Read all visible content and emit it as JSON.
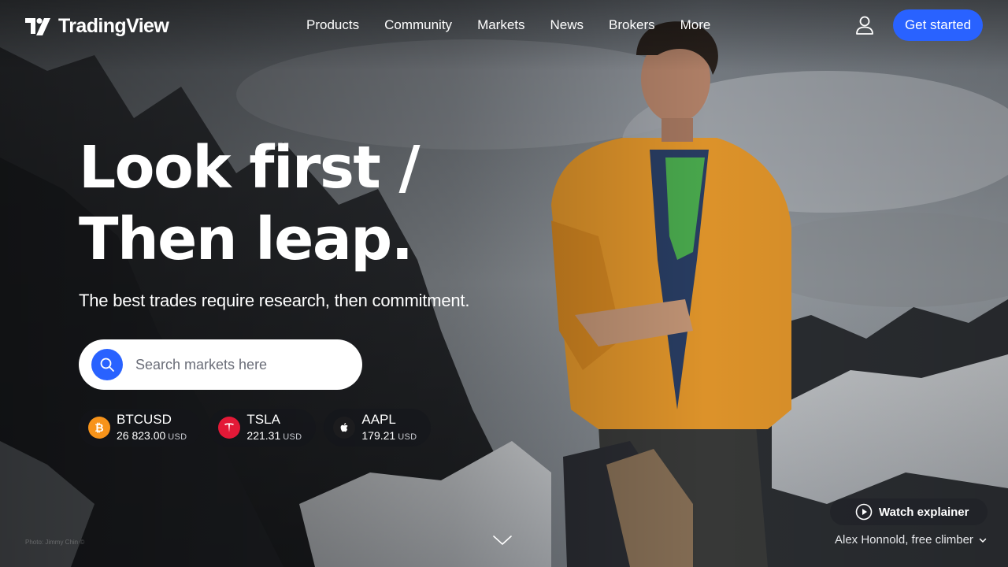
{
  "brand": {
    "name": "TradingView"
  },
  "nav": {
    "items": [
      {
        "label": "Products"
      },
      {
        "label": "Community"
      },
      {
        "label": "Markets"
      },
      {
        "label": "News"
      },
      {
        "label": "Brokers"
      },
      {
        "label": "More"
      }
    ],
    "cta_label": "Get started"
  },
  "hero": {
    "title_line1": "Look first /",
    "title_line2": "Then leap.",
    "subtitle": "The best trades require research, then commitment."
  },
  "search": {
    "placeholder": "Search markets here"
  },
  "tickers": [
    {
      "symbol": "BTCUSD",
      "value": "26 823.00",
      "currency": "USD",
      "icon": "bitcoin-icon",
      "color": "#f7931a"
    },
    {
      "symbol": "TSLA",
      "value": "221.31",
      "currency": "USD",
      "icon": "tesla-icon",
      "color": "#e31937"
    },
    {
      "symbol": "AAPL",
      "value": "179.21",
      "currency": "USD",
      "icon": "apple-icon",
      "color": "#1c1c1e"
    }
  ],
  "explainer": {
    "label": "Watch explainer"
  },
  "caption": {
    "text": "Alex Honnold, free climber"
  },
  "photo_credit": "Photo: Jimmy Chin ©",
  "colors": {
    "accent": "#2962ff",
    "jacket": "#e89a2c"
  }
}
